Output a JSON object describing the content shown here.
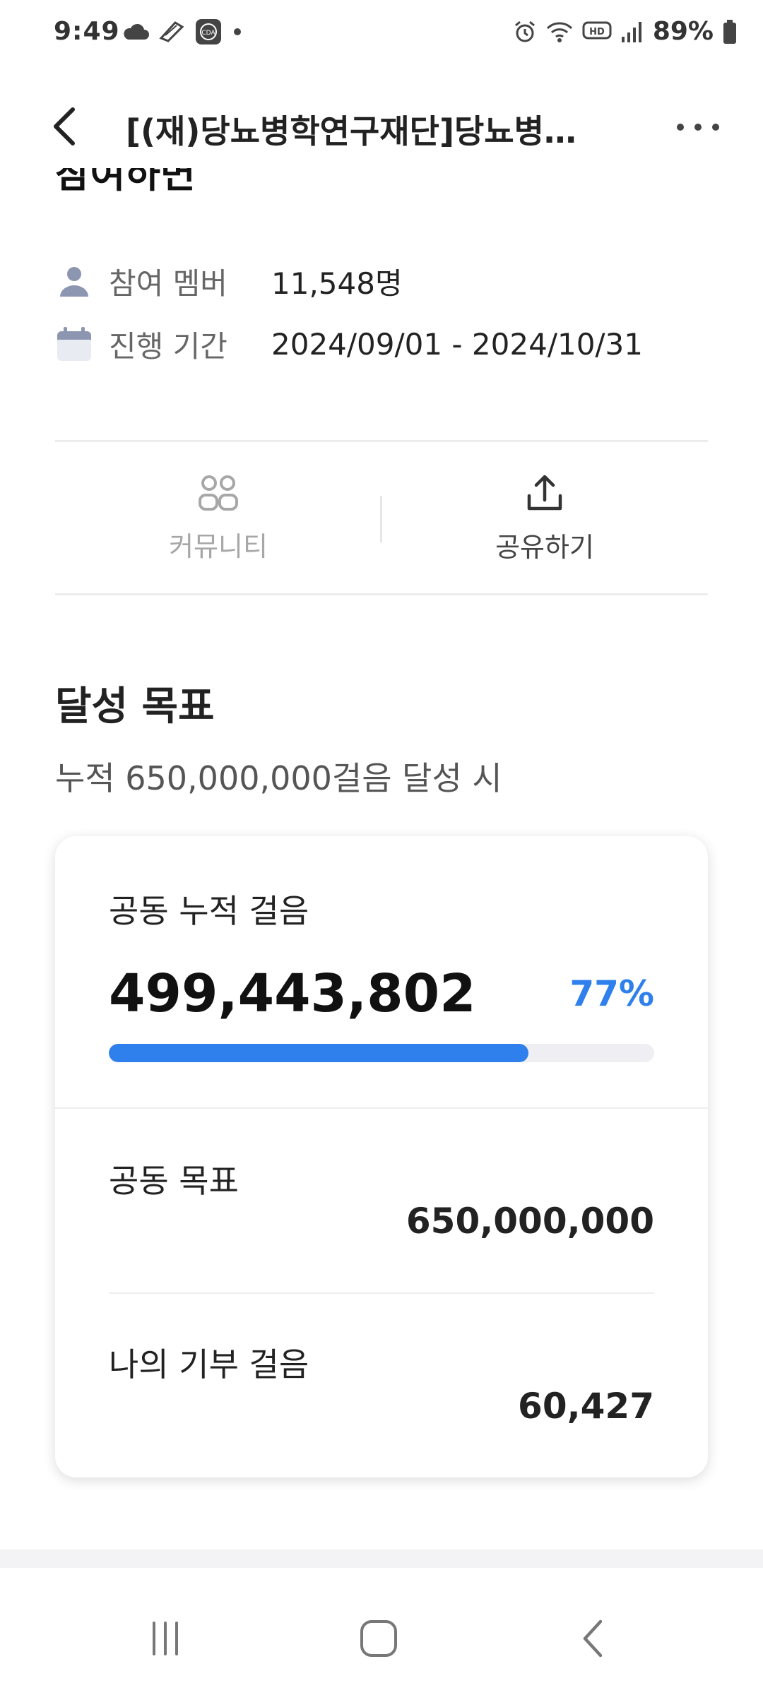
{
  "status_bar": {
    "time": "9:49",
    "left_icons": [
      "cloud-icon",
      "shoe-icon",
      "cda-app-icon",
      "dot-icon"
    ],
    "right_icons": [
      "alarm-icon",
      "wifi-icon",
      "hd-voice-icon",
      "signal-icon"
    ],
    "battery_text": "89%",
    "battery_level": 0.89
  },
  "app_bar": {
    "back_icon": "chevron-left-icon",
    "title": "[(재)당뇨병학연구재단]당뇨병…",
    "more_icon": "more-horizontal-icon"
  },
  "cut_heading": "참여하면",
  "info": {
    "members": {
      "icon": "person-icon",
      "label": "참여 멤버",
      "value": "11,548명"
    },
    "period": {
      "icon": "calendar-icon",
      "label": "진행 기간",
      "value": "2024/09/01 - 2024/10/31"
    }
  },
  "actions": {
    "community": {
      "icon": "community-icon",
      "label": "커뮤니티",
      "enabled": false
    },
    "share": {
      "icon": "share-icon",
      "label": "공유하기",
      "enabled": true
    }
  },
  "goal": {
    "title": "달성 목표",
    "description": "누적 650,000,000걸음 달성 시"
  },
  "card": {
    "cumulative_label": "공동 누적 걸음",
    "cumulative_value": "499,443,802",
    "percent_text": "77%",
    "progress_fraction": 0.77,
    "goal_label": "공동 목표",
    "goal_value": "650,000,000",
    "my_label": "나의 기부 걸음",
    "my_value": "60,427"
  },
  "colors": {
    "accent": "#2f80ed",
    "progress_track": "#efeff3",
    "icon_gray": "#8d96b0",
    "disabled_text": "#a7a7a7"
  },
  "nav_bar": {
    "recent_icon": "recent-apps-icon",
    "home_icon": "home-icon",
    "back_icon": "back-icon"
  }
}
